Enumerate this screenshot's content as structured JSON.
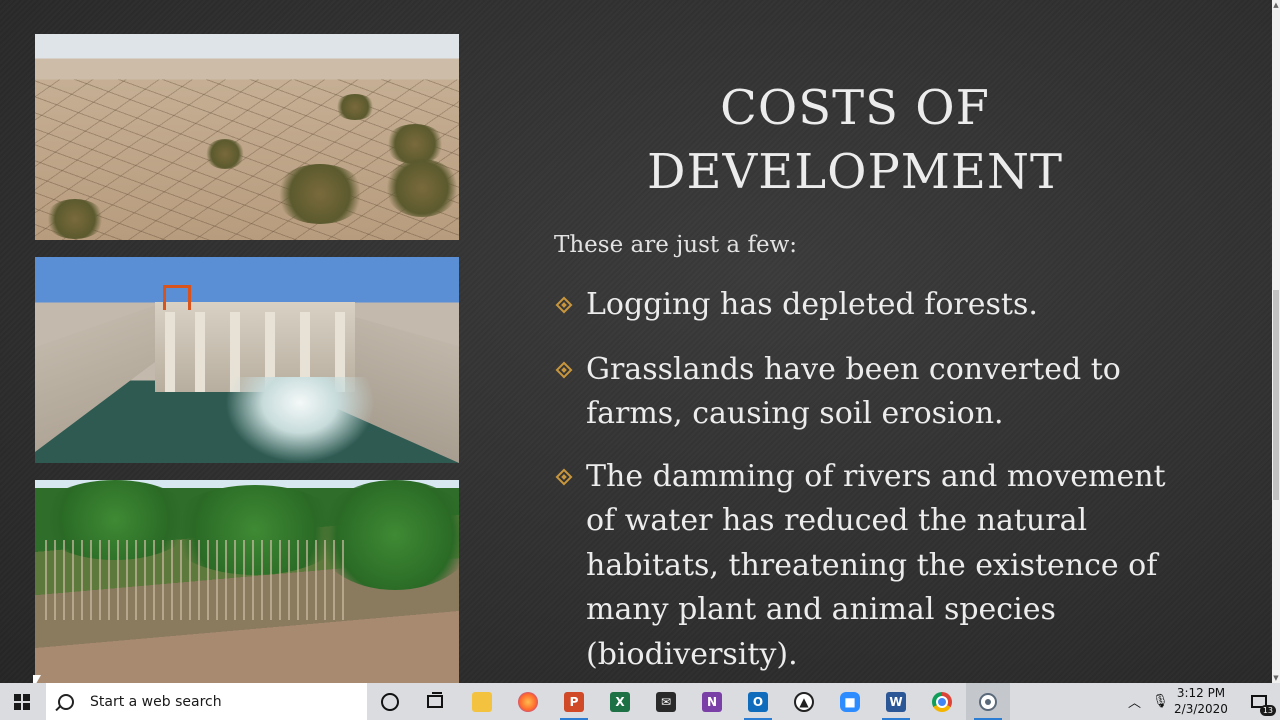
{
  "slide": {
    "title_line1": "COSTS OF",
    "title_line2": "DEVELOPMENT",
    "intro": "These are just a few:",
    "bullets": [
      "Logging has depleted forests.",
      "Grasslands have been converted to farms, causing soil erosion.",
      "The damming of rivers and movement of water has reduced the natural habitats, threatening the existence of many plant and animal species (biodiversity)."
    ],
    "bullet_color": "#c8963c"
  },
  "taskbar": {
    "search_placeholder": "Start a web search",
    "apps": [
      "file-explorer",
      "firefox",
      "powerpoint",
      "excel",
      "mail",
      "onenote",
      "outlook",
      "photos",
      "zoom",
      "word",
      "chrome",
      "screen-recorder"
    ],
    "clock_time": "3:12 PM",
    "clock_date": "2/3/2020",
    "notification_count": "13"
  },
  "colors": {
    "accent": "#c8963c",
    "slide_bg": "#2f2f2f",
    "text": "#ececec",
    "taskbar_bg": "#dadce0"
  }
}
